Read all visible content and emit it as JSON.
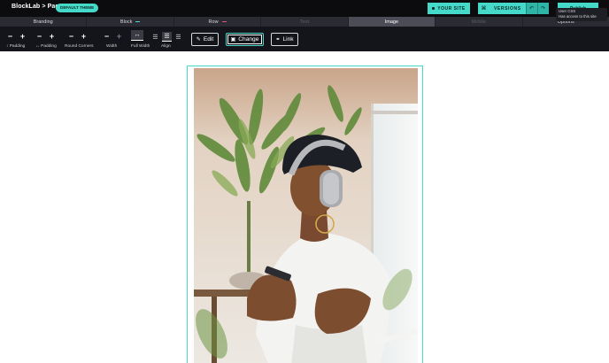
{
  "header": {
    "brand": "BlockLab > Page",
    "theme_badge": "DEFAULT THEME",
    "your_site_label": "YOUR SITE",
    "versions_label": "VERSIONS",
    "publish_label": "Publish"
  },
  "tooltip": {
    "line1": "User CSS",
    "line2": "Has access to this site"
  },
  "tabs": [
    {
      "label": "Branding",
      "state": "normal"
    },
    {
      "label": "Block",
      "state": "normal",
      "marker_color": "#44d9c8"
    },
    {
      "label": "Row",
      "state": "normal",
      "marker_color": "#e0527a"
    },
    {
      "label": "Text",
      "state": "disabled"
    },
    {
      "label": "Image",
      "state": "active"
    },
    {
      "label": "Mobile",
      "state": "disabled"
    },
    {
      "label": "Options",
      "state": "normal"
    }
  ],
  "toolbar": {
    "padding_v_label": "↕ Padding",
    "padding_h_label": "↔ Padding",
    "round_corners_label": "Round Corners",
    "width_label": "Width",
    "full_width_label": "Full Width",
    "align_label": "Align",
    "edit_label": "Edit",
    "change_label": "Change",
    "link_label": "Link",
    "minus": "−",
    "plus": "+"
  },
  "icons": {
    "edit": "pencil-icon",
    "change": "image-icon",
    "link": "link-icon",
    "full_width": "arrows-horizontal-icon",
    "align_left": "align-left-icon",
    "align_center": "align-center-icon",
    "align_right": "align-right-icon"
  },
  "colors": {
    "accent": "#44d9c8",
    "topbar_bg": "#0c0c0e",
    "toolbar_bg": "#14151a",
    "row_marker": "#e0527a"
  },
  "canvas": {
    "image_alt": "Woman in a black beanie and grey headphones looking at her phone"
  }
}
